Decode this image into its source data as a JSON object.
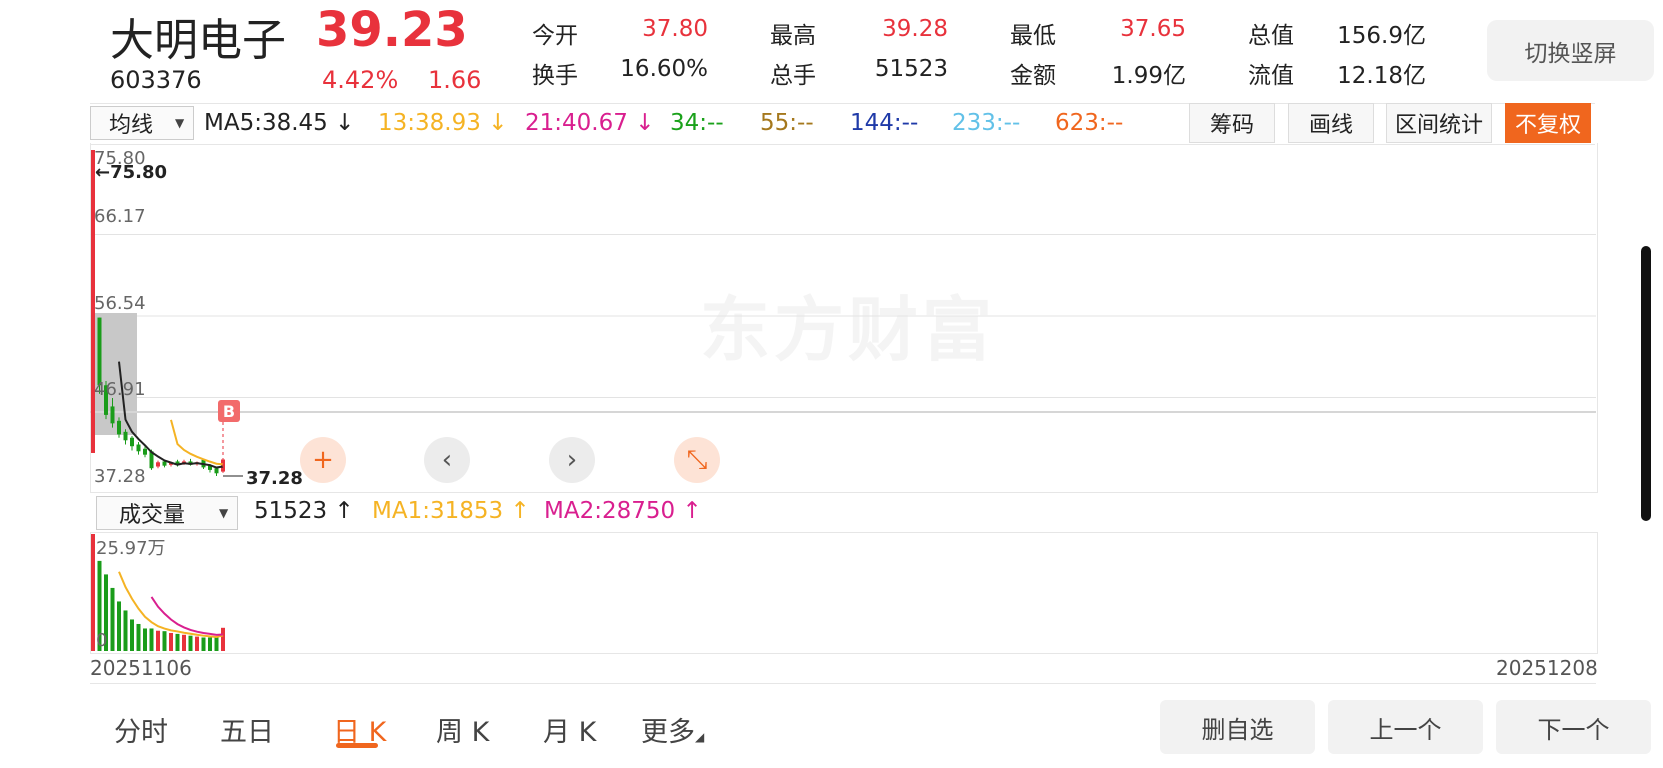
{
  "header": {
    "stock_name": "大明电子",
    "stock_code": "603376",
    "price": "39.23",
    "change_pct": "4.42%",
    "change_amt": "1.66",
    "quotes": {
      "open_label": "今开",
      "open_value": "37.80",
      "high_label": "最高",
      "high_value": "39.28",
      "low_label": "最低",
      "low_value": "37.65",
      "mktcap_label": "总值",
      "mktcap_value": "156.9亿",
      "turnover_label": "换手",
      "turnover_value": "16.60%",
      "volume_label": "总手",
      "volume_value": "51523",
      "amount_label": "金额",
      "amount_value": "1.99亿",
      "float_label": "流值",
      "float_value": "12.18亿"
    },
    "switch_label": "切换竖屏"
  },
  "ma_bar": {
    "selector": "均线",
    "ma5": "MA5:38.45",
    "ma13": "13:38.93",
    "ma21": "21:40.67",
    "ma34": "34:--",
    "ma55": "55:--",
    "ma144": "144:--",
    "ma233": "233:--",
    "ma623": "623:--",
    "arrow_down": "↓",
    "chips_btn": "筹码",
    "draw_btn": "画线",
    "range_btn": "区间统计",
    "adjust_btn": "不复权",
    "colors": {
      "ma5": "#222222",
      "ma13": "#f5b324",
      "ma21": "#d91f8f",
      "ma34": "#1aa11a",
      "ma55": "#a5781d",
      "ma144": "#1f3aa8",
      "ma233": "#62c1e8",
      "ma623": "#f0661e"
    }
  },
  "main_chart": {
    "y_labels": [
      "75.80",
      "66.17",
      "56.54",
      "46.91",
      "37.28"
    ],
    "high_marker": "←75.80",
    "low_marker": "37.28",
    "b_marker": "B",
    "watermark": "东方财富",
    "controls": {
      "zoom_in": "+",
      "prev": "‹",
      "next": "›",
      "shrink": "⤡"
    }
  },
  "volume_bar": {
    "selector": "成交量",
    "vol": "51523",
    "ma1": "MA1:31853",
    "ma2": "MA2:28750",
    "arrow_up": "↑",
    "max_label": "25.97万",
    "zero_label": "0"
  },
  "dates": {
    "start": "20251106",
    "end": "20251208"
  },
  "tabs": [
    "分时",
    "五日",
    "日 K",
    "周 K",
    "月 K",
    "更多"
  ],
  "active_tab": "日 K",
  "bottom_buttons": {
    "remove": "删自选",
    "prev": "上一个",
    "next": "下一个"
  },
  "chart_data": {
    "type": "candlestick",
    "x_range": [
      "20251106",
      "20251208"
    ],
    "ylim": [
      37.28,
      75.8
    ],
    "candles": [
      {
        "o": 40,
        "c": 75.8,
        "h": 75.8,
        "l": 40,
        "dir": "up"
      },
      {
        "o": 56,
        "c": 48,
        "h": 56,
        "l": 47,
        "dir": "down"
      },
      {
        "o": 48,
        "c": 44.5,
        "h": 48.5,
        "l": 44,
        "dir": "down"
      },
      {
        "o": 45.5,
        "c": 43.5,
        "h": 46.5,
        "l": 43,
        "dir": "down"
      },
      {
        "o": 43.8,
        "c": 42.2,
        "h": 44.2,
        "l": 41.8,
        "dir": "down"
      },
      {
        "o": 42.5,
        "c": 41.5,
        "h": 42.8,
        "l": 41.0,
        "dir": "down"
      },
      {
        "o": 41.8,
        "c": 40.8,
        "h": 42.0,
        "l": 40.3,
        "dir": "down"
      },
      {
        "o": 41.0,
        "c": 40.2,
        "h": 41.3,
        "l": 39.8,
        "dir": "down"
      },
      {
        "o": 40.5,
        "c": 39.8,
        "h": 40.8,
        "l": 39.5,
        "dir": "down"
      },
      {
        "o": 40.2,
        "c": 38.2,
        "h": 40.4,
        "l": 38.0,
        "dir": "down"
      },
      {
        "o": 38.4,
        "c": 38.9,
        "h": 39.1,
        "l": 38.2,
        "dir": "up"
      },
      {
        "o": 39.0,
        "c": 38.5,
        "h": 39.2,
        "l": 38.3,
        "dir": "down"
      },
      {
        "o": 38.6,
        "c": 38.9,
        "h": 39.0,
        "l": 38.4,
        "dir": "up"
      },
      {
        "o": 39.0,
        "c": 38.6,
        "h": 39.2,
        "l": 38.4,
        "dir": "down"
      },
      {
        "o": 38.8,
        "c": 39.0,
        "h": 39.2,
        "l": 38.6,
        "dir": "up"
      },
      {
        "o": 39.0,
        "c": 38.6,
        "h": 39.3,
        "l": 38.5,
        "dir": "down"
      },
      {
        "o": 38.7,
        "c": 38.9,
        "h": 39.0,
        "l": 38.5,
        "dir": "up"
      },
      {
        "o": 39.2,
        "c": 38.3,
        "h": 39.3,
        "l": 38.1,
        "dir": "down"
      },
      {
        "o": 38.5,
        "c": 38.0,
        "h": 38.7,
        "l": 37.7,
        "dir": "down"
      },
      {
        "o": 38.2,
        "c": 37.6,
        "h": 38.4,
        "l": 37.28,
        "dir": "down"
      },
      {
        "o": 37.8,
        "c": 39.23,
        "h": 39.28,
        "l": 37.65,
        "dir": "up"
      }
    ],
    "volumes": [
      25.97,
      20,
      17,
      14,
      11,
      9,
      7,
      6,
      5,
      5,
      4.5,
      4.4,
      4,
      3.8,
      3.6,
      3.4,
      3.2,
      3,
      3,
      3,
      5.15
    ],
    "volume_unit": "万"
  }
}
